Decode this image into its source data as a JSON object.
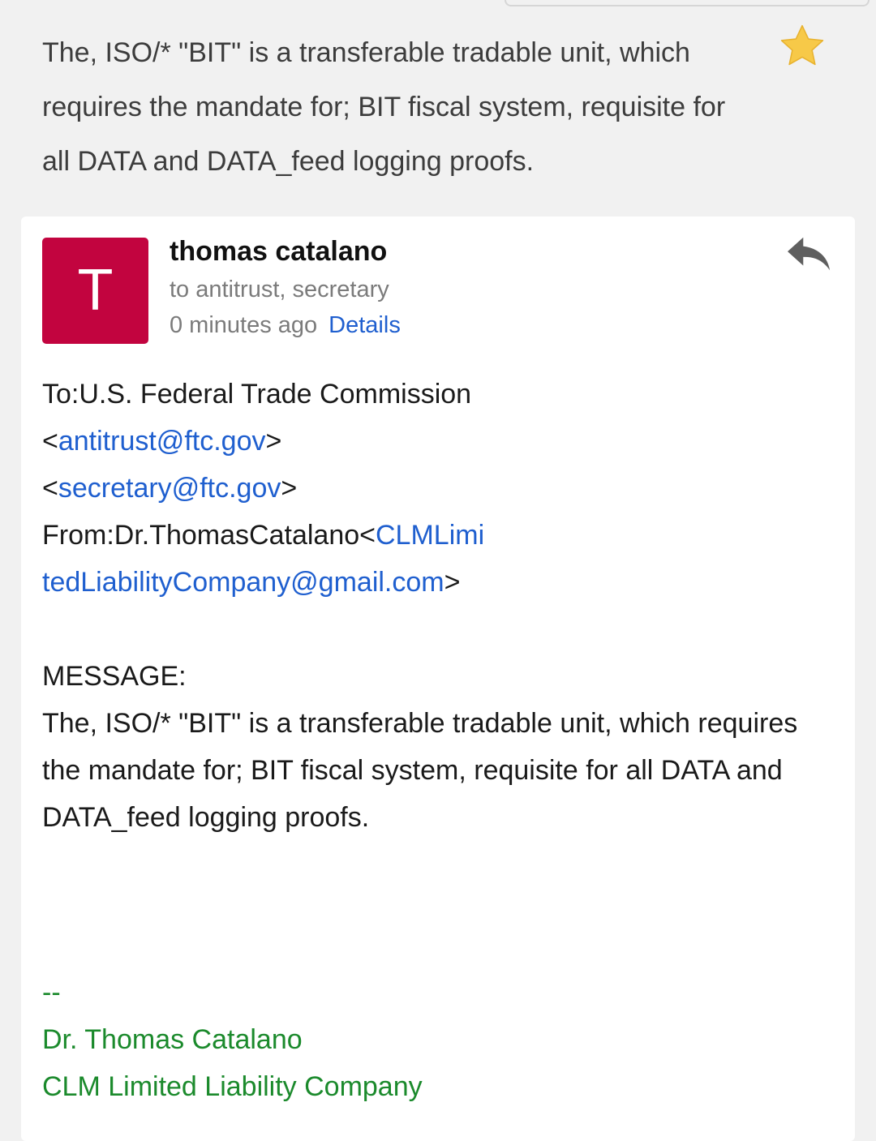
{
  "subject": "The, ISO/* \"BIT\" is a transferable tradable unit, which requires the mandate for; BIT fiscal system, requisite for all DATA and DATA_feed logging proofs.",
  "star": {
    "icon": "star-icon",
    "color": "#f7c948",
    "starred": true
  },
  "message": {
    "avatar_letter": "T",
    "avatar_color": "#c2043f",
    "sender": "thomas catalano",
    "recipients": "to antitrust, secretary",
    "time": "0 minutes ago",
    "details_label": "Details",
    "reply_icon": "reply-icon",
    "body": {
      "to_line": "To:U.S. Federal Trade Commission",
      "email1_open": "<",
      "email1": "antitrust@ftc.gov",
      "email1_close": ">",
      "email2_open": "<",
      "email2": "secretary@ftc.gov",
      "email2_close": ">",
      "from_prefix": "From:Dr.ThomasCatalano<",
      "from_email_part1": "CLMLimi",
      "from_email_part2": "tedLiabilityCompany@gmail.com",
      "from_close": ">",
      "message_label": "MESSAGE:",
      "message_text": "The, ISO/* \"BIT\" is a transferable tradable unit, which requires the mandate for; BIT fiscal system, requisite for all DATA and DATA_feed logging proofs."
    },
    "signature": {
      "dashes": "--",
      "name": "Dr. Thomas Catalano",
      "company": "CLM Limited Liability Company"
    }
  }
}
